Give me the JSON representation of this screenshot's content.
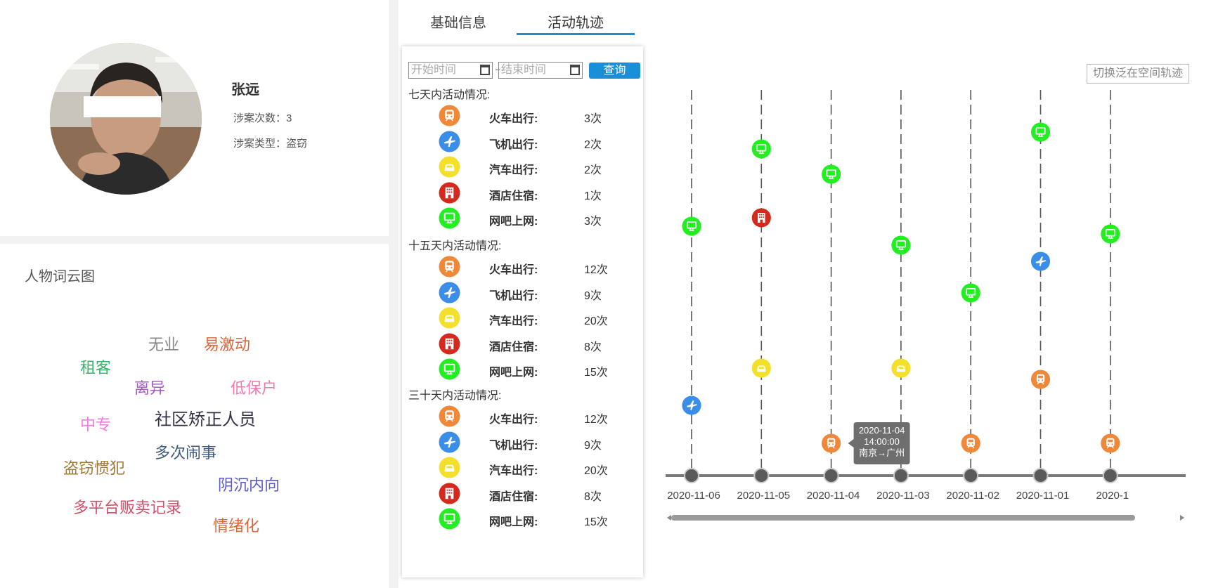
{
  "profile": {
    "name": "张远",
    "case_count_label": "涉案次数：3",
    "case_type_label": "涉案类型：盗窃"
  },
  "word_cloud": {
    "title": "人物词云图",
    "words": [
      {
        "text": "无业",
        "color": "#888888"
      },
      {
        "text": "易激动",
        "color": "#d9663a"
      },
      {
        "text": "租客",
        "color": "#3cb36b"
      },
      {
        "text": "离异",
        "color": "#a855c8"
      },
      {
        "text": "低保户",
        "color": "#f07ab0"
      },
      {
        "text": "中专",
        "color": "#f27ae0"
      },
      {
        "text": "社区矫正人员",
        "color": "#333344"
      },
      {
        "text": "多次闹事",
        "color": "#3f5a7a"
      },
      {
        "text": "盗窃惯犯",
        "color": "#a07a3a"
      },
      {
        "text": "阴沉内向",
        "color": "#5a5ac8"
      },
      {
        "text": "多平台贩卖记录",
        "color": "#d0506a"
      },
      {
        "text": "情绪化",
        "color": "#d9663a"
      }
    ]
  },
  "tabs": [
    {
      "label": "基础信息",
      "active": false
    },
    {
      "label": "活动轨迹",
      "active": true
    }
  ],
  "filters": {
    "start_placeholder": "开始时间",
    "end_placeholder": "结束时间",
    "query_label": "查询"
  },
  "switch_label": "切换泛在空间轨迹",
  "colors": {
    "train": "#f0883a",
    "plane": "#3a8ee8",
    "car": "#f4e02a",
    "hotel": "#d42a1e",
    "internet": "#22ee22",
    "accent": "#1a8fd8"
  },
  "stat_sections": [
    {
      "title": "七天内活动情况:",
      "rows": [
        {
          "icon": "train-icon",
          "type": "train",
          "label": "火车出行:",
          "count": "3次"
        },
        {
          "icon": "plane-icon",
          "type": "plane",
          "label": "飞机出行:",
          "count": "2次"
        },
        {
          "icon": "car-icon",
          "type": "car",
          "label": "汽车出行:",
          "count": "2次"
        },
        {
          "icon": "hotel-icon",
          "type": "hotel",
          "label": "酒店住宿:",
          "count": "1次"
        },
        {
          "icon": "internet-icon",
          "type": "internet",
          "label": "网吧上网:",
          "count": "3次"
        }
      ]
    },
    {
      "title": "十五天内活动情况:",
      "rows": [
        {
          "icon": "train-icon",
          "type": "train",
          "label": "火车出行:",
          "count": "12次"
        },
        {
          "icon": "plane-icon",
          "type": "plane",
          "label": "飞机出行:",
          "count": "9次"
        },
        {
          "icon": "car-icon",
          "type": "car",
          "label": "汽车出行:",
          "count": "20次"
        },
        {
          "icon": "hotel-icon",
          "type": "hotel",
          "label": "酒店住宿:",
          "count": "8次"
        },
        {
          "icon": "internet-icon",
          "type": "internet",
          "label": "网吧上网:",
          "count": "15次"
        }
      ]
    },
    {
      "title": "三十天内活动情况:",
      "rows": [
        {
          "icon": "train-icon",
          "type": "train",
          "label": "火车出行:",
          "count": "12次"
        },
        {
          "icon": "plane-icon",
          "type": "plane",
          "label": "飞机出行:",
          "count": "9次"
        },
        {
          "icon": "car-icon",
          "type": "car",
          "label": "汽车出行:",
          "count": "20次"
        },
        {
          "icon": "hotel-icon",
          "type": "hotel",
          "label": "酒店住宿:",
          "count": "8次"
        },
        {
          "icon": "internet-icon",
          "type": "internet",
          "label": "网吧上网:",
          "count": "15次"
        }
      ]
    }
  ],
  "timeline": {
    "dates": [
      "2020-11-06",
      "2020-11-05",
      "2020-11-04",
      "2020-11-03",
      "2020-11-02",
      "2020-11-01",
      "2020-1"
    ],
    "events": [
      {
        "date": "2020-11-06",
        "type": "internet"
      },
      {
        "date": "2020-11-06",
        "type": "plane"
      },
      {
        "date": "2020-11-05",
        "type": "internet"
      },
      {
        "date": "2020-11-05",
        "type": "hotel"
      },
      {
        "date": "2020-11-05",
        "type": "car"
      },
      {
        "date": "2020-11-04",
        "type": "internet"
      },
      {
        "date": "2020-11-04",
        "type": "train"
      },
      {
        "date": "2020-11-03",
        "type": "internet"
      },
      {
        "date": "2020-11-03",
        "type": "car"
      },
      {
        "date": "2020-11-02",
        "type": "internet"
      },
      {
        "date": "2020-11-02",
        "type": "train"
      },
      {
        "date": "2020-11-01",
        "type": "internet"
      },
      {
        "date": "2020-11-01",
        "type": "plane"
      },
      {
        "date": "2020-11-01",
        "type": "train"
      },
      {
        "date": "2020-1",
        "type": "internet"
      },
      {
        "date": "2020-1",
        "type": "train"
      }
    ],
    "tooltip": {
      "date": "2020-11-04",
      "time": "14:00:00",
      "route": "南京→广州"
    }
  }
}
